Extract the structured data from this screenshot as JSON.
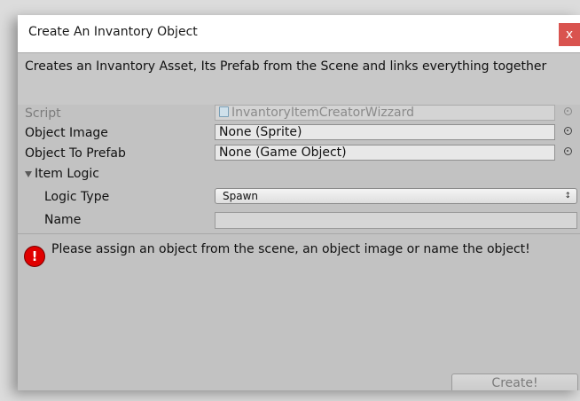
{
  "window": {
    "title": "Create An Invantory Object",
    "close_label": "x"
  },
  "help": {
    "text": "Creates an Invantory Asset, Its Prefab from the Scene and links everything together"
  },
  "fields": {
    "script": {
      "label": "Script",
      "value": "InvantoryItemCreatorWizzard"
    },
    "object_image": {
      "label": "Object Image",
      "value": "None (Sprite)"
    },
    "object_to_prefab": {
      "label": "Object To Prefab",
      "value": "None (Game Object)"
    },
    "item_logic": {
      "label": "Item Logic"
    },
    "logic_type": {
      "label": "Logic Type",
      "value": "Spawn"
    },
    "name": {
      "label": "Name",
      "value": ""
    }
  },
  "error": {
    "icon": "error-icon",
    "message": "Please assign an object from the scene, an object image or name the object!"
  },
  "actions": {
    "create_label": "Create!"
  },
  "colors": {
    "close_button": "#d9534f",
    "error_icon": "#e00000",
    "panel_bg": "#c2c2c2"
  }
}
